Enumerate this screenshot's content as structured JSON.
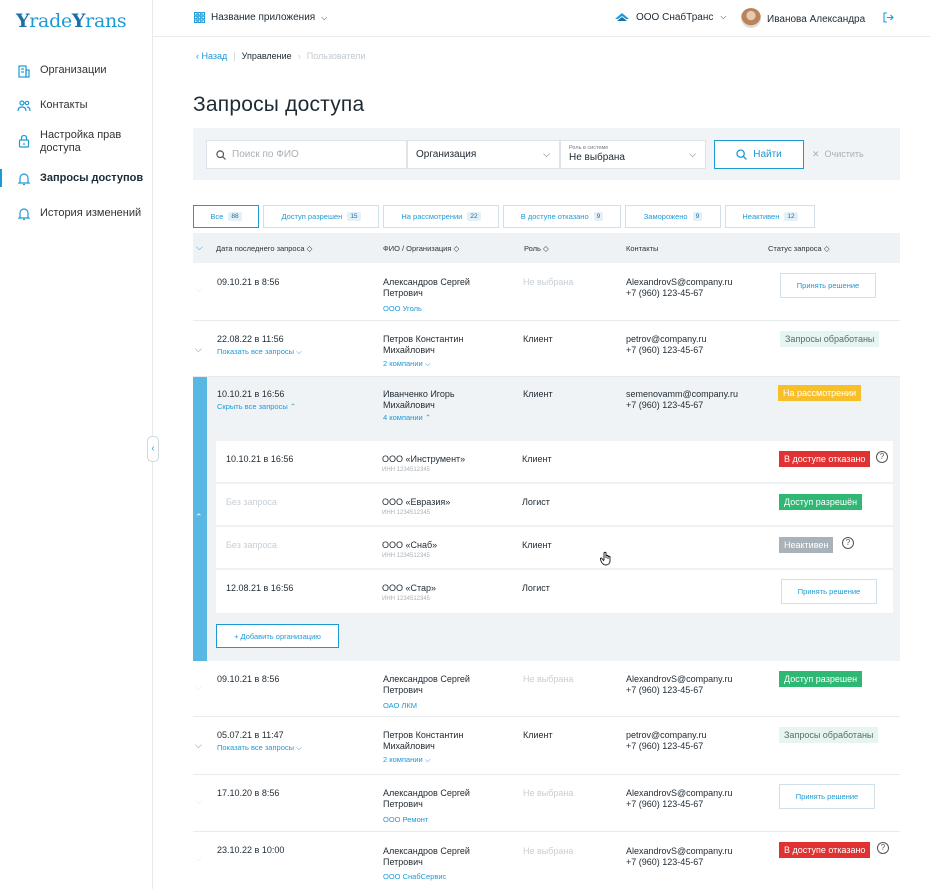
{
  "brand": {
    "logo_text_1": "rade",
    "logo_text_2": "rans",
    "logo_letter": "Y",
    "accent": "#1d9ad6"
  },
  "sidebar": {
    "items": [
      {
        "label": "Организации",
        "icon": "building-icon"
      },
      {
        "label": "Контакты",
        "icon": "users-icon"
      },
      {
        "label": "Настройка прав доступа",
        "icon": "lock-icon"
      },
      {
        "label": "Запросы доступов",
        "icon": "bell-icon",
        "active": true
      },
      {
        "label": "История изменений",
        "icon": "bell-icon"
      }
    ]
  },
  "header": {
    "app_name": "Название приложения",
    "company": "ООО СнабТранс",
    "user": "Иванова Александра"
  },
  "breadcrumb": {
    "back": "Назад",
    "level1": "Управление",
    "level2": "Пользователи"
  },
  "page_title": "Запросы доступа",
  "filters": {
    "search_placeholder": "Поиск по ФИО",
    "org_label": "Организация",
    "role_caption": "Роль в системе",
    "role_value": "Не выбрана",
    "find": "Найти",
    "clear": "Очистить"
  },
  "tabs": [
    {
      "label": "Все",
      "count": "88"
    },
    {
      "label": "Доступ разрешен",
      "count": "15"
    },
    {
      "label": "На рассмотрении",
      "count": "22"
    },
    {
      "label": "В доступе отказано",
      "count": "9"
    },
    {
      "label": "Заморожено",
      "count": "9"
    },
    {
      "label": "Неактивен",
      "count": "12"
    }
  ],
  "columns": {
    "date": "Дата последнего запроса",
    "name": "ФИО / Организация",
    "role": "Роль",
    "contacts": "Контакты",
    "status": "Статус запроса"
  },
  "rows": [
    {
      "date": "09.10.21 в 8:56",
      "name1": "Александров Сергей",
      "name2": "Петрович",
      "org": "ООО Уголь",
      "role": "Не выбрана",
      "email": "AlexandrovS@company.ru",
      "phone": "+7 (960) 123-45-67",
      "action": "Принять решение"
    },
    {
      "date": "22.08.22 в 11:56",
      "link": "Показать все запросы",
      "name1": "Петров Константин",
      "name2": "Михайлович",
      "org": "2 компании",
      "role": "Клиент",
      "email": "petrov@company.ru",
      "phone": "+7 (960) 123-45-67",
      "status": "Запросы обработаны"
    },
    {
      "date": "10.10.21 в 16:56",
      "link": "Скрыть все запросы",
      "name1": "Иванченко Игорь",
      "name2": "Михайлович",
      "org": "4 компании",
      "role": "Клиент",
      "email": "semenovamm@company.ru",
      "phone": "+7 (960) 123-45-67",
      "status": "На рассмотрении"
    },
    {
      "date": "09.10.21 в 8:56",
      "name1": "Александров Сергей",
      "name2": "Петрович",
      "org": "ОАО ЛКМ",
      "role": "Не выбрана",
      "email": "AlexandrovS@company.ru",
      "phone": "+7 (960) 123-45-67",
      "status": "Доступ разрешен"
    },
    {
      "date": "05.07.21 в 11:47",
      "link": "Показать все запросы",
      "name1": "Петров Константин",
      "name2": "Михайлович",
      "org": "2 компании",
      "role": "Клиент",
      "email": "petrov@company.ru",
      "phone": "+7 (960) 123-45-67",
      "status": "Запросы обработаны"
    },
    {
      "date": "17.10.20 в 8:56",
      "name1": "Александров Сергей",
      "name2": "Петрович",
      "org": "ООО Ремонт",
      "role": "Не выбрана",
      "email": "AlexandrovS@company.ru",
      "phone": "+7 (960) 123-45-67",
      "action": "Принять решение"
    },
    {
      "date": "23.10.22 в 10:00",
      "name1": "Александров Сергей",
      "name2": "Петрович",
      "org": "ООО СнабСервис",
      "role": "Не выбрана",
      "email": "AlexandrovS@company.ru",
      "phone": "+7 (960) 123-45-67",
      "status": "В доступе отказано"
    }
  ],
  "subrows": [
    {
      "date": "10.10.21 в 16:56",
      "org": "ООО «Инструмент»",
      "inn": "ИНН 1234512345",
      "role": "Клиент",
      "status": "В доступе отказано"
    },
    {
      "date": "Без запроса",
      "org": "ООО «Евразия»",
      "inn": "ИНН 1234512345",
      "role": "Логист",
      "status": "Доступ разрешён"
    },
    {
      "date": "Без запроса",
      "org": "ООО «Снаб»",
      "inn": "ИНН 1234512345",
      "role": "Клиент",
      "status": "Неактивен"
    },
    {
      "date": "12.08.21 в 16:56",
      "org": "ООО «Стар»",
      "inn": "ИНН 1234512345",
      "role": "Логист",
      "action": "Принять решение"
    }
  ],
  "add_org": "+ Добавить организацию"
}
